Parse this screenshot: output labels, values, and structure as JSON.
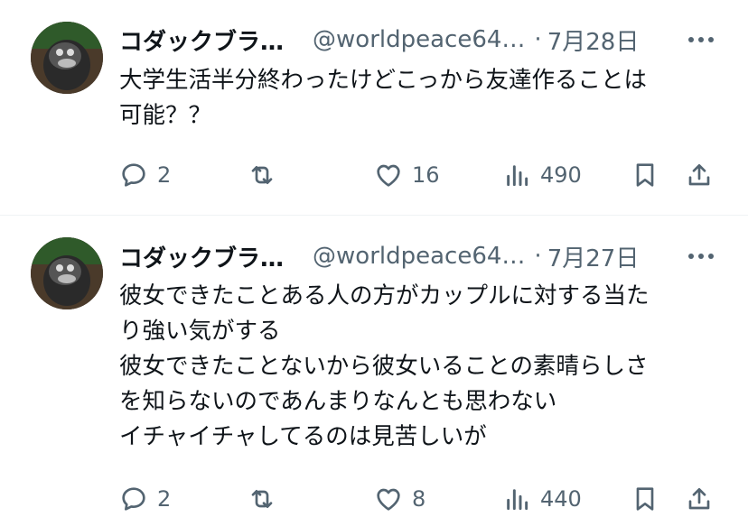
{
  "tweets": [
    {
      "name": "コダックブラ…",
      "handle": "@worldpeace64…",
      "dot": "·",
      "date": "7月28日",
      "lines": [
        "大学生活半分終わったけどこっから友達作ることは",
        "可能？？"
      ],
      "replies": "2",
      "retweets": "",
      "likes": "16",
      "views": "490"
    },
    {
      "name": "コダックブラ…",
      "handle": "@worldpeace64…",
      "dot": "·",
      "date": "7月27日",
      "lines": [
        "彼女できたことある人の方がカップルに対する当た",
        "り強い気がする",
        "彼女できたことないから彼女いることの素晴らしさ",
        "を知らないのであんまりなんとも思わない",
        "イチャイチャしてるのは見苦しいが"
      ],
      "replies": "2",
      "retweets": "",
      "likes": "8",
      "views": "440"
    }
  ],
  "icons": {
    "reply": "reply-icon",
    "retweet": "retweet-icon",
    "like": "heart-icon",
    "views": "views-icon",
    "bookmark": "bookmark-icon",
    "share": "share-icon",
    "more": "more-icon"
  },
  "colors": {
    "text": "#0f1419",
    "secondary": "#536471",
    "divider": "#eff3f4"
  }
}
